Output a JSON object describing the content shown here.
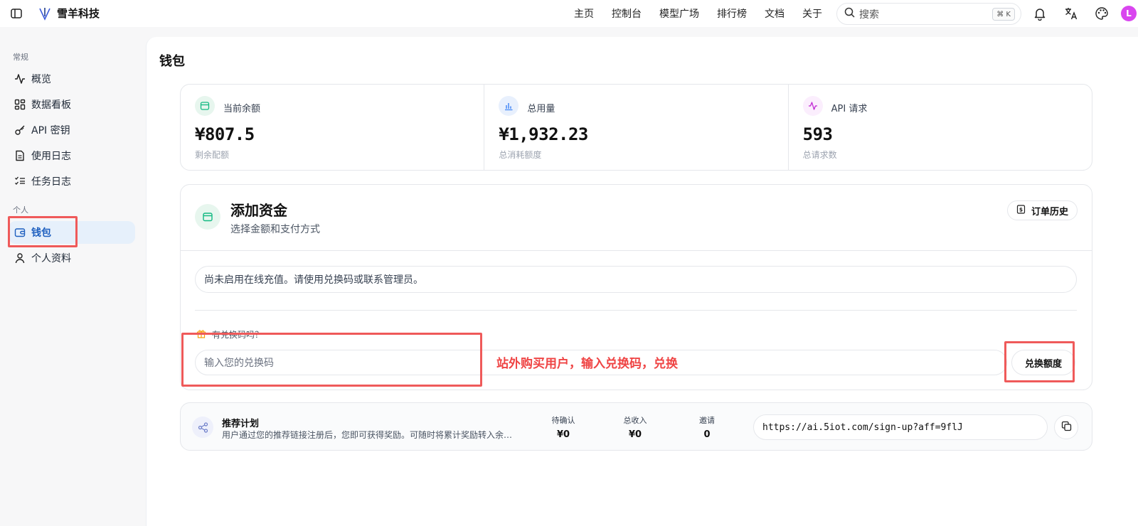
{
  "topbar": {
    "brand_name": "雪羊科技",
    "nav": [
      "主页",
      "控制台",
      "模型广场",
      "排行榜",
      "文档",
      "关于"
    ],
    "search_placeholder": "搜索",
    "search_shortcut": "⌘ K",
    "avatar_initial": "L"
  },
  "sidebar": {
    "section_general": "常规",
    "section_personal": "个人",
    "items": [
      {
        "label": "概览",
        "icon": "activity-icon"
      },
      {
        "label": "数据看板",
        "icon": "dashboard-icon"
      },
      {
        "label": "API 密钥",
        "icon": "key-icon"
      },
      {
        "label": "使用日志",
        "icon": "file-text-icon"
      },
      {
        "label": "任务日志",
        "icon": "list-check-icon"
      },
      {
        "label": "钱包",
        "icon": "wallet-icon",
        "active": true
      },
      {
        "label": "个人资料",
        "icon": "user-icon"
      }
    ]
  },
  "page": {
    "title": "钱包"
  },
  "stats": [
    {
      "label": "当前余额",
      "value": "¥807.5",
      "sub": "剩余配额",
      "icon": "wallet-icon",
      "color": "#10b981"
    },
    {
      "label": "总用量",
      "value": "¥1,932.23",
      "sub": "总消耗额度",
      "icon": "bar-chart-icon",
      "color": "#3b82f6"
    },
    {
      "label": "API 请求",
      "value": "593",
      "sub": "总请求数",
      "icon": "activity-icon",
      "color": "#c026d3"
    }
  ],
  "fund": {
    "title": "添加资金",
    "subtitle": "选择金额和支付方式",
    "order_history": "订单历史",
    "notice": "尚未启用在线充值。请使用兑换码或联系管理员。",
    "redeem_label": "有兑换码吗？",
    "redeem_placeholder": "输入您的兑换码",
    "redeem_button": "兑换额度"
  },
  "annotation": {
    "text": "站外购买用户，输入兑换码，兑换",
    "color": "#ef4444"
  },
  "referral": {
    "title": "推荐计划",
    "desc": "用户通过您的推荐链接注册后，您即可获得奖励。可随时将累计奖励转入余…",
    "stats": [
      {
        "label": "待确认",
        "value": "¥0"
      },
      {
        "label": "总收入",
        "value": "¥0"
      },
      {
        "label": "邀请",
        "value": "0"
      }
    ],
    "link": "https://ai.5iot.com/sign-up?aff=9flJ"
  }
}
